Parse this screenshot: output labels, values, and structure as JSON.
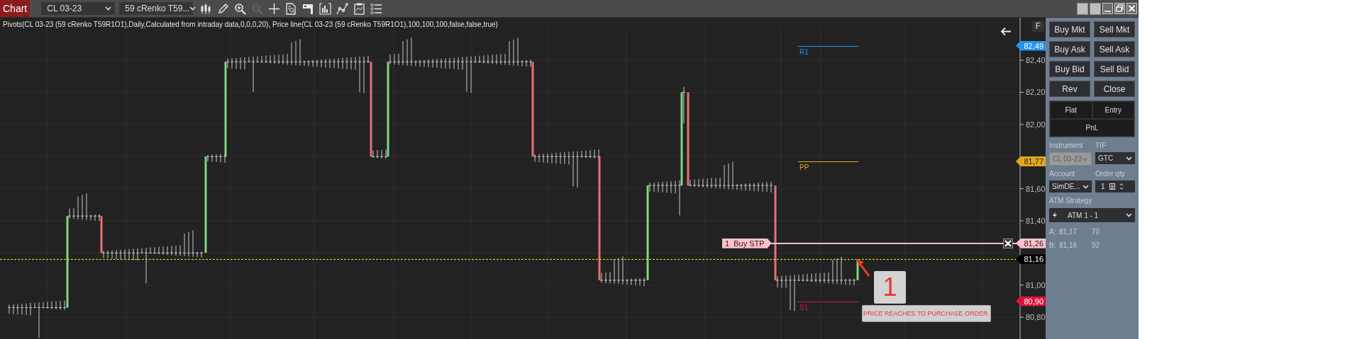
{
  "toolbar": {
    "title": "Chart",
    "instrument": "CL 03-23",
    "bars_type": "59 cRenko T59...",
    "tools": [
      {
        "kind": "bars",
        "disabled": false
      },
      {
        "kind": "pencil",
        "disabled": false
      },
      {
        "kind": "zoom-in",
        "disabled": false
      },
      {
        "kind": "zoom-out",
        "disabled": true
      },
      {
        "kind": "crosshair",
        "disabled": false
      },
      {
        "kind": "document",
        "disabled": false
      },
      {
        "kind": "flag",
        "disabled": false
      },
      {
        "kind": "columns",
        "disabled": false
      },
      {
        "kind": "line",
        "disabled": false
      },
      {
        "kind": "clipboard",
        "disabled": false
      },
      {
        "kind": "list",
        "disabled": false
      }
    ]
  },
  "chart": {
    "indicator_label": "Pivots(CL 03-23 (59 cRenko T59R1O1),Daily,Calculated from intraday data,0,0,0,20), Price line(CL 03-23 (59 cRenko T59R1O1),100,100,100,false,false,true)",
    "f_button": "F",
    "price_axis": [
      "82,40",
      "82,20",
      "82,00",
      "81,60",
      "81,40",
      "81,00",
      "80,80"
    ],
    "price_markers": [
      {
        "kind": "pivot",
        "label": "82,49",
        "pivot": "R1",
        "color": "#2196f3"
      },
      {
        "kind": "pivot",
        "label": "81,77",
        "pivot": "PP",
        "color": "#e0a820"
      },
      {
        "kind": "order",
        "label": "81,26",
        "quantity": "1",
        "order_type": "Buy STP",
        "color": "#ffc0cb"
      },
      {
        "kind": "last",
        "label": "81,16",
        "color": "#000000"
      },
      {
        "kind": "pivot",
        "label": "80,90",
        "pivot": "S1",
        "color": "#dc143c"
      }
    ],
    "annotation": {
      "number": "1",
      "note": "PRICE REACHES TO PURCHASE ORDER."
    }
  },
  "order_panel": {
    "buttons": [
      "Buy Mkt",
      "Sell Mkt",
      "Buy Ask",
      "Sell Ask",
      "Buy Bid",
      "Sell Bid",
      "Rev",
      "Close"
    ],
    "position": {
      "flat": "Flat",
      "entry": "Entry",
      "pnl": "PnL"
    },
    "instrument": {
      "label": "Instrument",
      "value": "CL 03-23",
      "disabled": true
    },
    "tif": {
      "label": "TIF",
      "value": "GTC",
      "disabled": false
    },
    "account": {
      "label": "Account",
      "value": "SimDE...",
      "disabled": false
    },
    "order_qty": {
      "label": "Order qty",
      "value": "1"
    },
    "atm_strategy": {
      "label": "ATM Strategy",
      "value": "ATM 1 - 1"
    },
    "quotes": [
      {
        "side": "A:",
        "price": "81,17",
        "size": "70"
      },
      {
        "side": "B:",
        "price": "81,16",
        "size": "92"
      }
    ]
  }
}
